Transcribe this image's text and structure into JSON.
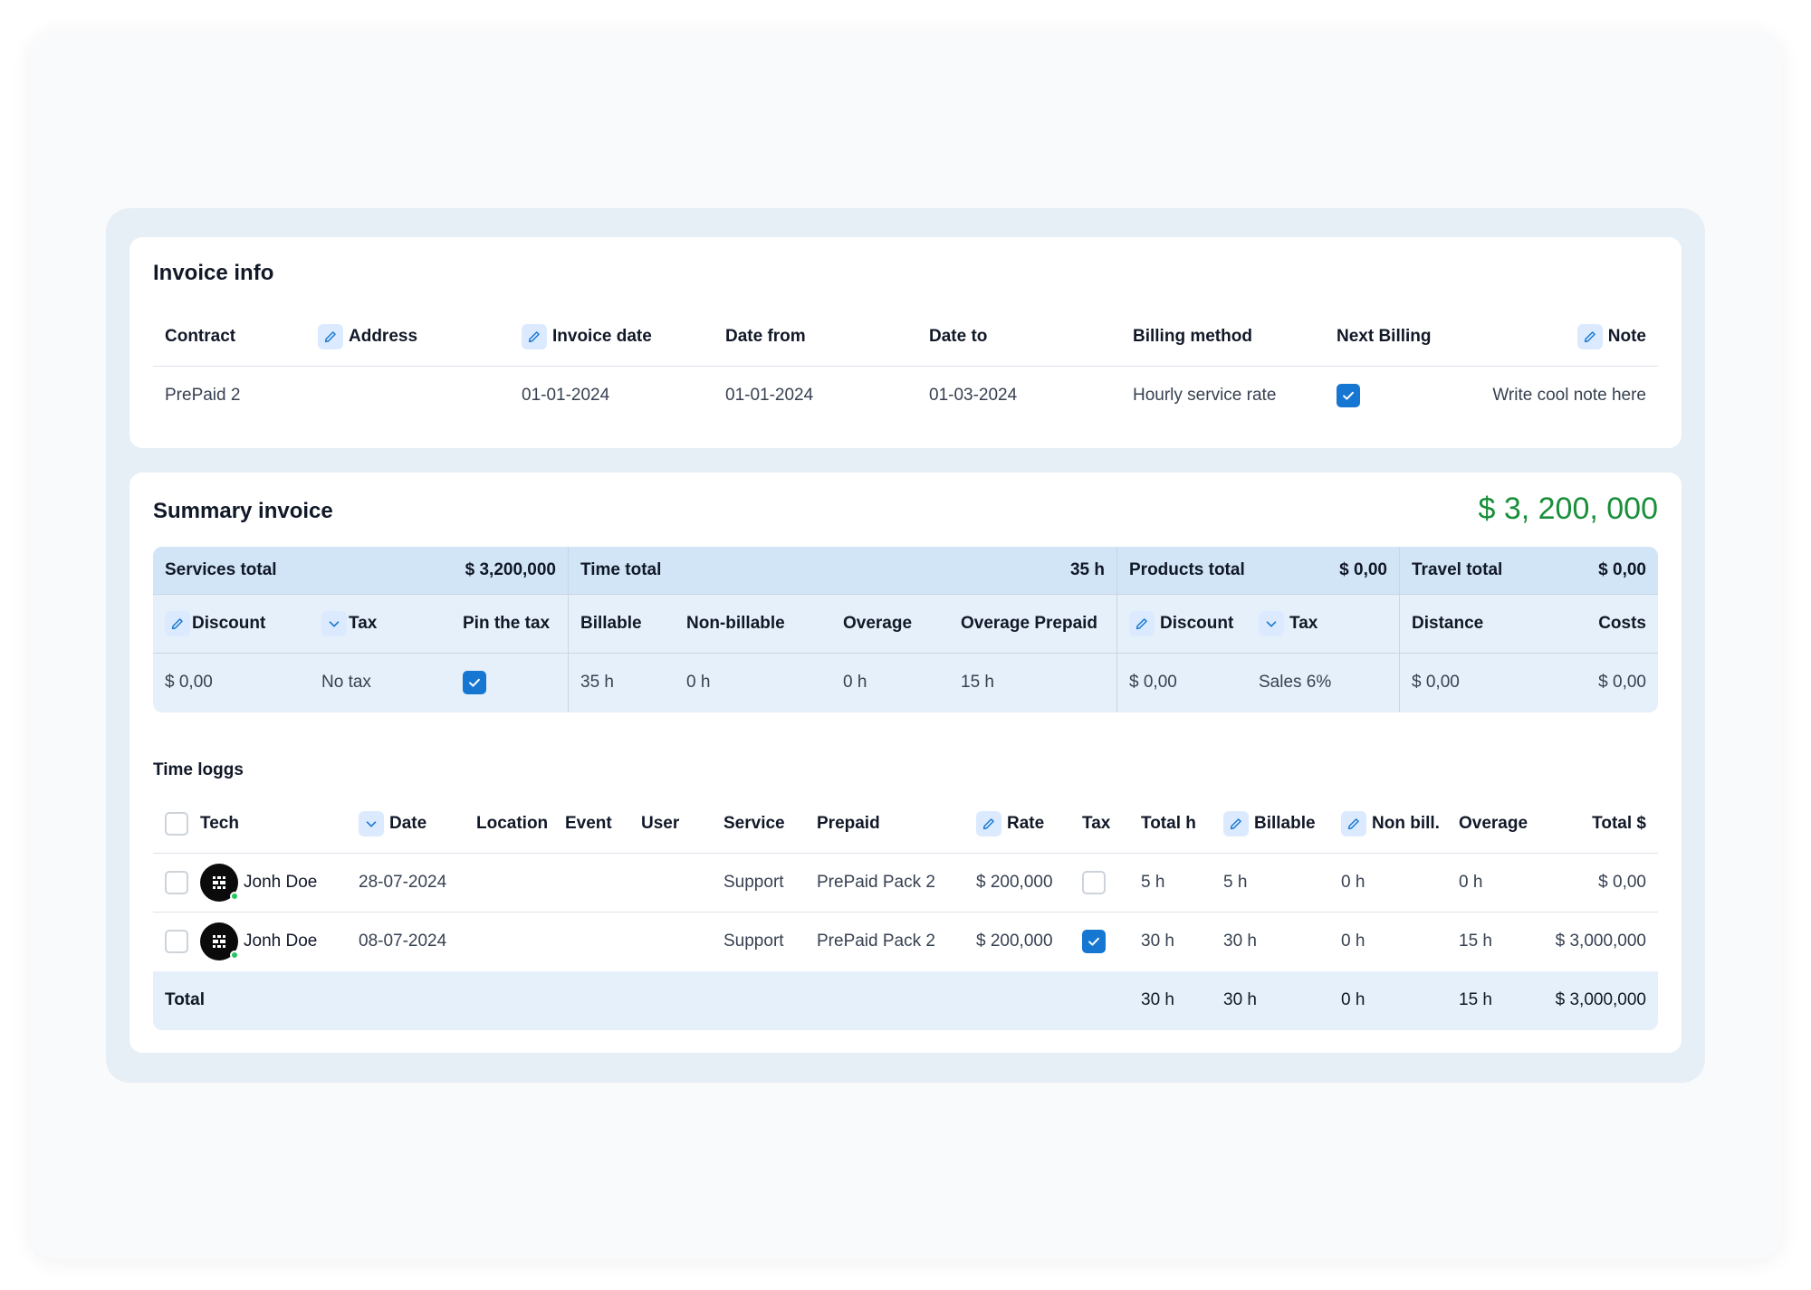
{
  "invoice_info": {
    "title": "Invoice info",
    "headers": {
      "contract": "Contract",
      "address": "Address",
      "invoice_date": "Invoice date",
      "date_from": "Date from",
      "date_to": "Date to",
      "billing_method": "Billing method",
      "next_billing": "Next Billing",
      "note": "Note"
    },
    "row": {
      "contract": "PrePaid 2",
      "address": "",
      "invoice_date": "01-01-2024",
      "date_from": "01-01-2024",
      "date_to": "01-03-2024",
      "billing_method": "Hourly service rate",
      "next_billing_checked": true,
      "note": "Write cool note here"
    }
  },
  "summary": {
    "title": "Summary invoice",
    "grand_total": "$ 3, 200, 000",
    "grand_total_color": "#1a8f3a",
    "sections": {
      "services_total_label": "Services total",
      "services_total_value": "$ 3,200,000",
      "time_total_label": "Time total",
      "time_total_value": "35 h",
      "products_total_label": "Products total",
      "products_total_value": "$ 0,00",
      "travel_total_label": "Travel total",
      "travel_total_value": "$ 0,00"
    },
    "subheaders": {
      "discount": "Discount",
      "tax": "Tax",
      "pin_the_tax": "Pin the tax",
      "billable": "Billable",
      "non_billable": "Non-billable",
      "overage": "Overage",
      "overage_prepaid": "Overage Prepaid",
      "products_discount": "Discount",
      "products_tax": "Tax",
      "distance": "Distance",
      "costs": "Costs"
    },
    "values": {
      "discount": "$ 0,00",
      "tax": "No tax",
      "pin_the_tax_checked": true,
      "billable": "35 h",
      "non_billable": "0 h",
      "overage": "0 h",
      "overage_prepaid": "15 h",
      "products_discount": "$ 0,00",
      "products_tax": "Sales 6%",
      "distance": "$ 0,00",
      "costs": "$ 0,00"
    }
  },
  "time_logs": {
    "title": "Time loggs",
    "headers": {
      "tech": "Tech",
      "date": "Date",
      "location": "Location",
      "event": "Event",
      "user": "User",
      "service": "Service",
      "prepaid": "Prepaid",
      "rate": "Rate",
      "tax": "Tax",
      "total_h": "Total h",
      "billable": "Billable",
      "non_bill": "Non bill.",
      "overage": "Overage",
      "total_dollar": "Total $"
    },
    "rows": [
      {
        "tech": "Jonh Doe",
        "date": "28-07-2024",
        "service": "Support",
        "prepaid": "PrePaid Pack 2",
        "rate": "$ 200,000",
        "tax_checked": false,
        "total_h": "5 h",
        "billable": "5 h",
        "non_bill": "0 h",
        "overage": "0 h",
        "total_dollar": "$ 0,00"
      },
      {
        "tech": "Jonh Doe",
        "date": "08-07-2024",
        "service": "Support",
        "prepaid": "PrePaid Pack 2",
        "rate": "$ 200,000",
        "tax_checked": true,
        "total_h": "30 h",
        "billable": "30 h",
        "non_bill": "0 h",
        "overage": "15 h",
        "total_dollar": "$ 3,000,000"
      }
    ],
    "total": {
      "label": "Total",
      "total_h": "30 h",
      "billable": "30 h",
      "non_bill": "0 h",
      "overage": "15 h",
      "total_dollar": "$ 3,000,000"
    }
  }
}
